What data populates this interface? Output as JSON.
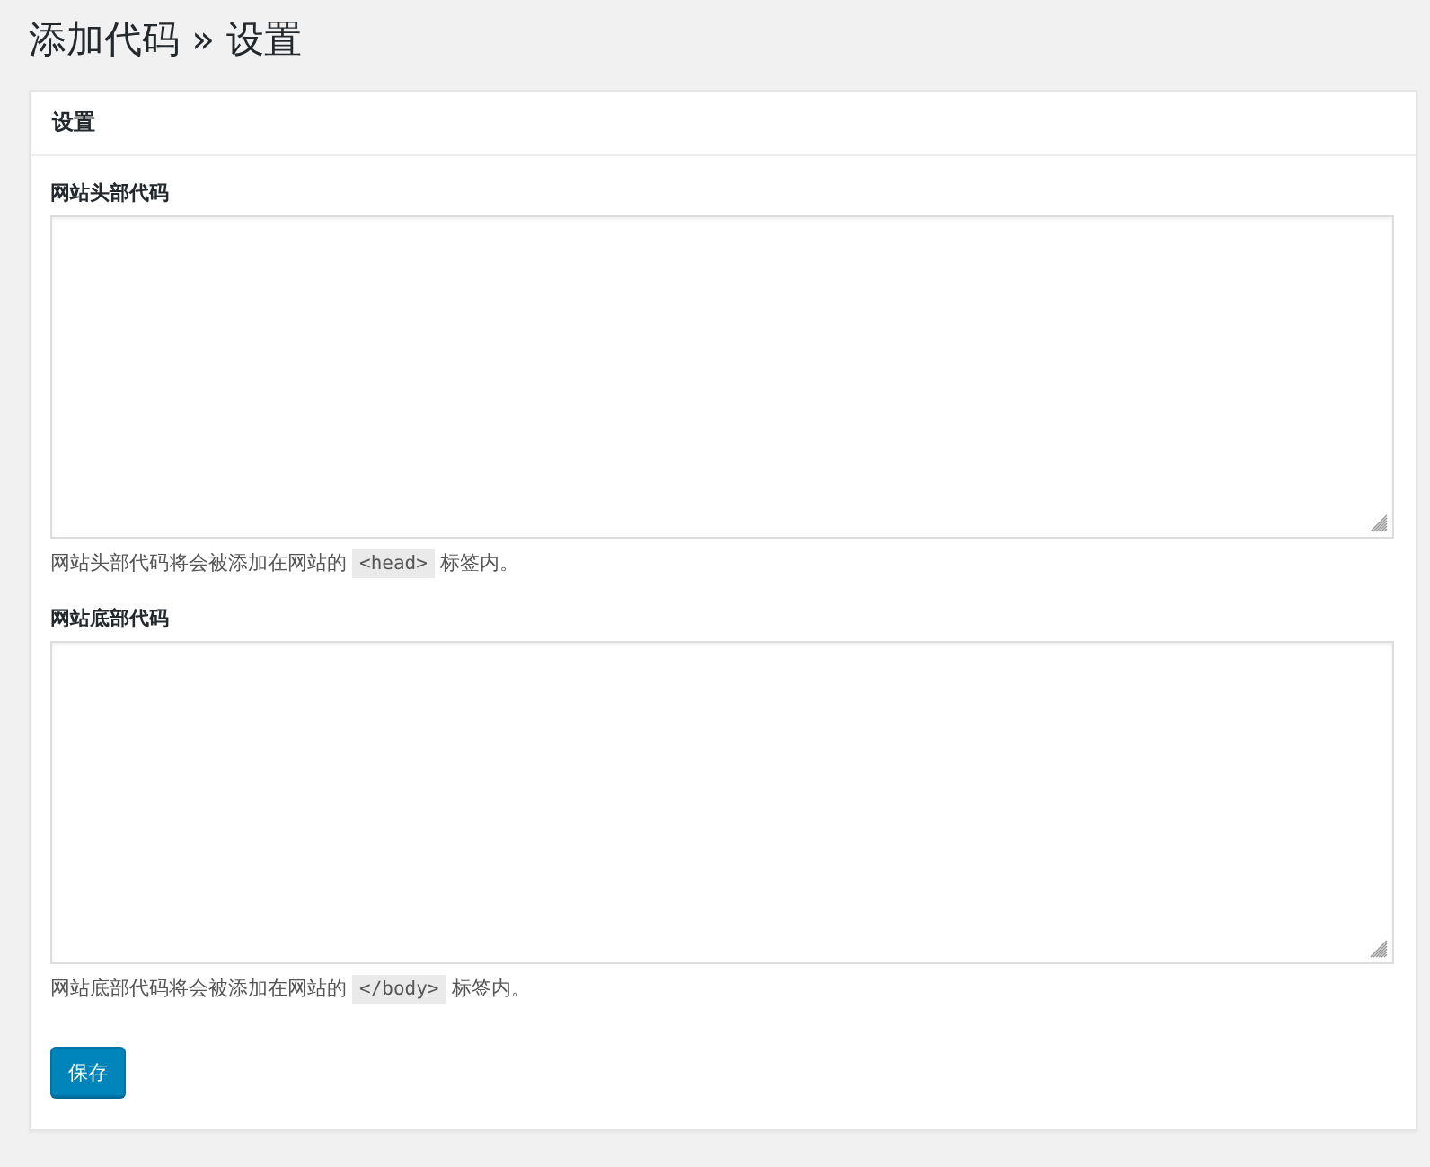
{
  "page_title": "添加代码 » 设置",
  "panel": {
    "title": "设置",
    "fields": [
      {
        "label": "网站头部代码",
        "description": {
          "before": "网站头部代码将会被添加在网站的",
          "code": "<head>",
          "after": "标签内。"
        }
      },
      {
        "label": "网站底部代码",
        "description": {
          "before": "网站底部代码将会被添加在网站的",
          "code": "</body>",
          "after": "标签内。"
        }
      }
    ],
    "button": "保存"
  }
}
